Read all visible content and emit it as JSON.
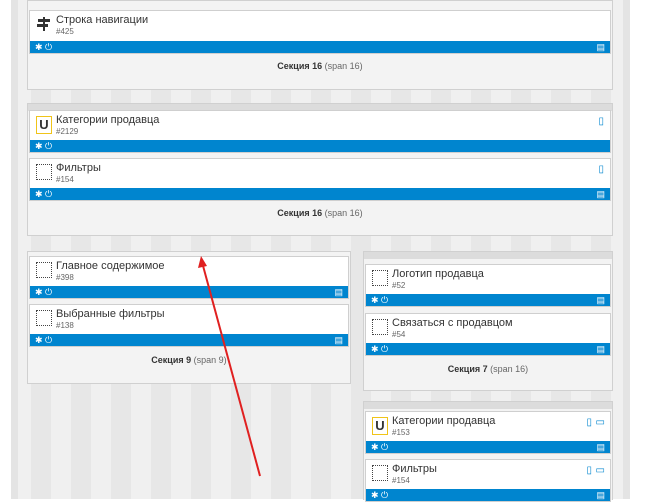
{
  "colors": {
    "accent": "#0085cf",
    "annotation_arrow": "#e02020",
    "vendor_icon_border": "#f0c419"
  },
  "icons": {
    "gear": "gear-icon",
    "power": "power-icon",
    "trash": "trash-icon",
    "mobile": "mobile-icon",
    "desktop": "desktop-icon",
    "signpost": "signpost-icon"
  },
  "sections": {
    "s1": {
      "label": "Секция 16",
      "span": "(span 16)"
    },
    "s2": {
      "label": "Секция 16",
      "span": "(span 16)"
    },
    "s3": {
      "label": "Секция 9",
      "span": "(span 9)"
    },
    "s4": {
      "label": "Секция 7",
      "span": "(span 16)"
    }
  },
  "blocks": {
    "nav": {
      "title": "Строка навигации",
      "id": "#425"
    },
    "vendor_cats": {
      "title": "Категории продавца",
      "id": "#2129"
    },
    "filters1": {
      "title": "Фильтры",
      "id": "#154"
    },
    "main": {
      "title": "Главное содержимое",
      "id": "#398"
    },
    "selected_filters": {
      "title": "Выбранные фильтры",
      "id": "#138"
    },
    "vendor_logo": {
      "title": "Логотип продавца",
      "id": "#52"
    },
    "contact_vendor": {
      "title": "Связаться с продавцом",
      "id": "#54"
    },
    "vendor_cats2": {
      "title": "Категории продавца",
      "id": "#153"
    },
    "filters2": {
      "title": "Фильтры",
      "id": "#154"
    }
  }
}
